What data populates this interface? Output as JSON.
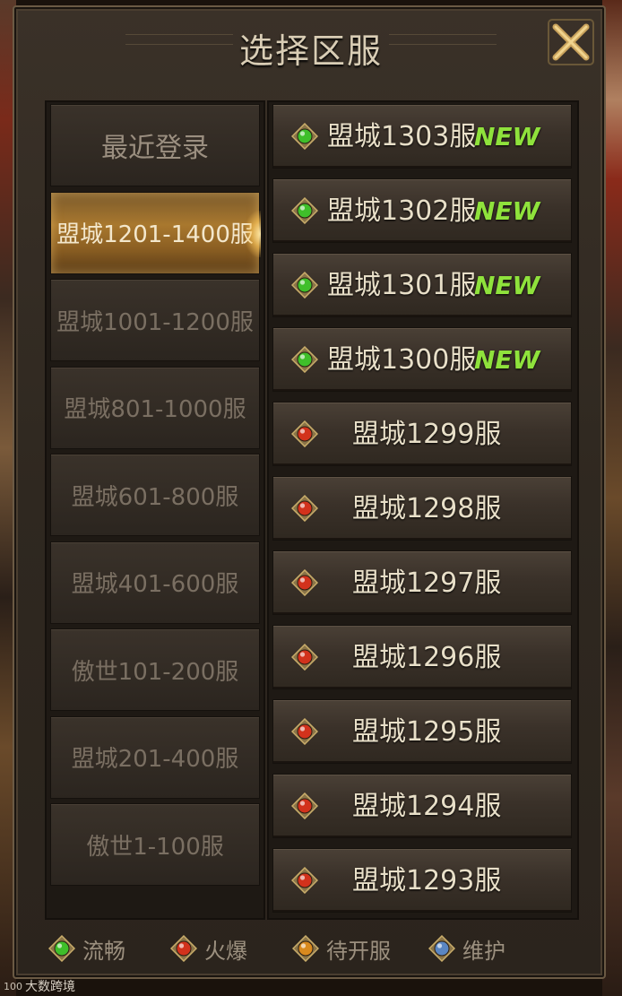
{
  "title": "选择区服",
  "categories": [
    {
      "label": "最近登录",
      "selected": false,
      "kind": "recent"
    },
    {
      "label": "盟城1201-1400服",
      "selected": true
    },
    {
      "label": "盟城1001-1200服",
      "selected": false
    },
    {
      "label": "盟城801-1000服",
      "selected": false
    },
    {
      "label": "盟城601-800服",
      "selected": false
    },
    {
      "label": "盟城401-600服",
      "selected": false
    },
    {
      "label": "傲世101-200服",
      "selected": false
    },
    {
      "label": "盟城201-400服",
      "selected": false
    },
    {
      "label": "傲世1-100服",
      "selected": false
    }
  ],
  "servers": [
    {
      "name": "盟城1303服",
      "status": "green",
      "badge": "NEW"
    },
    {
      "name": "盟城1302服",
      "status": "green",
      "badge": "NEW"
    },
    {
      "name": "盟城1301服",
      "status": "green",
      "badge": "NEW"
    },
    {
      "name": "盟城1300服",
      "status": "green",
      "badge": "NEW"
    },
    {
      "name": "盟城1299服",
      "status": "red",
      "badge": ""
    },
    {
      "name": "盟城1298服",
      "status": "red",
      "badge": ""
    },
    {
      "name": "盟城1297服",
      "status": "red",
      "badge": ""
    },
    {
      "name": "盟城1296服",
      "status": "red",
      "badge": ""
    },
    {
      "name": "盟城1295服",
      "status": "red",
      "badge": ""
    },
    {
      "name": "盟城1294服",
      "status": "red",
      "badge": ""
    },
    {
      "name": "盟城1293服",
      "status": "red",
      "badge": ""
    }
  ],
  "legend": [
    {
      "label": "流畅",
      "status": "green"
    },
    {
      "label": "火爆",
      "status": "red"
    },
    {
      "label": "待开服",
      "status": "orange"
    },
    {
      "label": "维护",
      "status": "blue"
    }
  ],
  "status_colors": {
    "green": "#3fbf2a",
    "red": "#d2321c",
    "orange": "#d98a1e",
    "blue": "#5a86c2"
  },
  "watermark": "大数跨境",
  "icons": {
    "close": "close-x-icon",
    "gem": "gem-status-icon"
  }
}
